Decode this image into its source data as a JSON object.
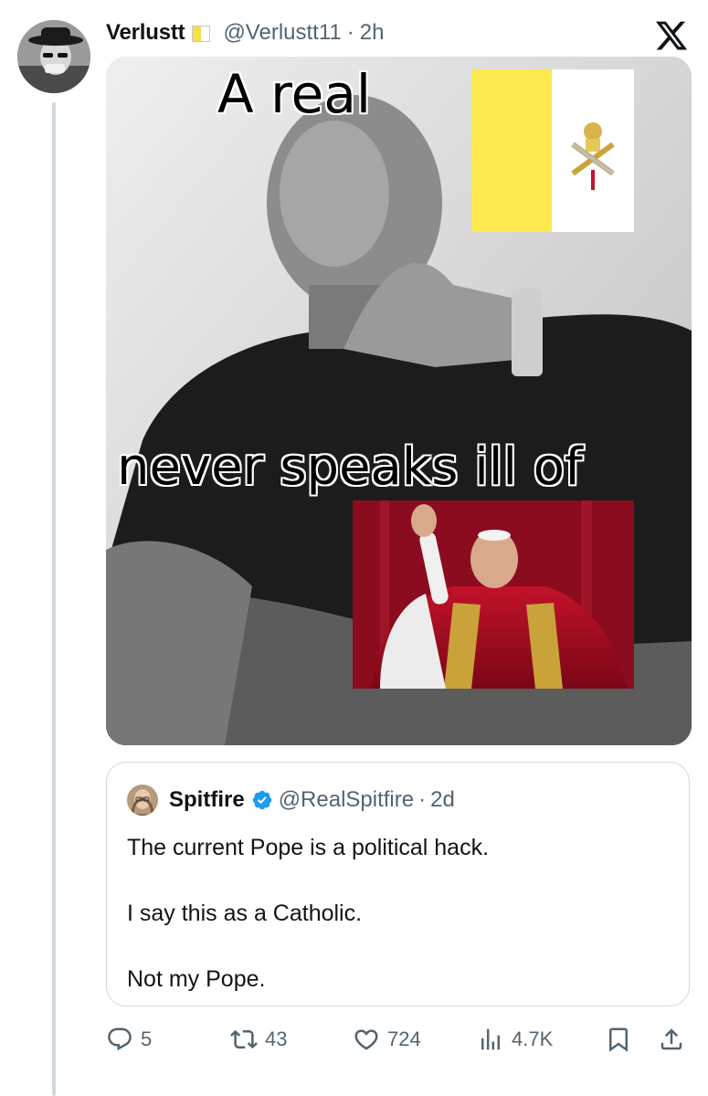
{
  "post": {
    "display_name": "Verlustt",
    "handle": "@Verlustt11",
    "separator": "·",
    "time": "2h",
    "meme_top_text": "A real",
    "meme_bottom_text": "never speaks ill of"
  },
  "quoted_post": {
    "display_name": "Spitfire",
    "handle": "@RealSpitfire",
    "separator": "·",
    "time": "2d",
    "lines": [
      "The current Pope is a political hack.",
      "I say this as a Catholic.",
      "Not my Pope."
    ]
  },
  "actions": {
    "replies": "5",
    "reposts": "43",
    "likes": "724",
    "views": "4.7K"
  },
  "icons": {
    "brand": "x-logo-icon",
    "verified": "verified-badge-icon",
    "affiliation": "vatican-flag-badge-icon",
    "reply": "reply-icon",
    "repost": "repost-icon",
    "like": "heart-icon",
    "views": "views-icon",
    "bookmark": "bookmark-icon",
    "share": "share-icon"
  },
  "colors": {
    "text_primary": "#0f1419",
    "text_secondary": "#536471",
    "border": "#cfd9de",
    "verified_blue": "#1d9bf0",
    "flag_yellow": "#f4e04b"
  }
}
